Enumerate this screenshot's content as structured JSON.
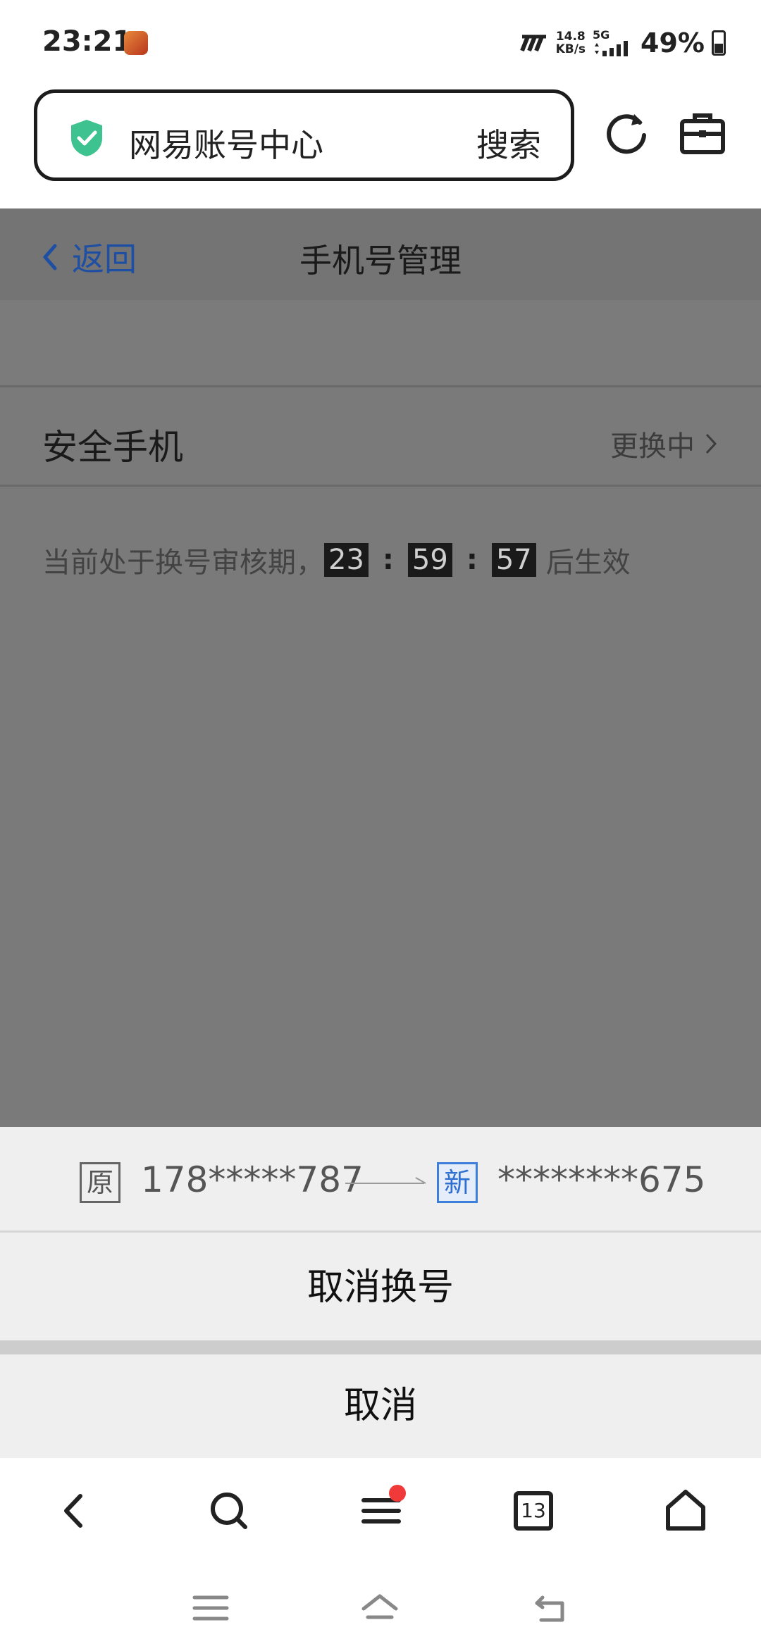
{
  "status_bar": {
    "time": "23:21",
    "net_speed_value": "14.8",
    "net_speed_unit": "KB/s",
    "network_type": "5G",
    "battery_percent": "49%",
    "battery_level": 0.49
  },
  "address_bar": {
    "site_text": "网易账号中心",
    "search_label": "搜索",
    "shield_icon": "shield-check-icon",
    "shield_color": "#3ec28f"
  },
  "page": {
    "back_label": "返回",
    "title": "手机号管理",
    "security_phone_label": "安全手机",
    "status_value": "更换中",
    "notice_prefix": "当前处于换号审核期，",
    "countdown_hours": "23",
    "countdown_minutes": "59",
    "countdown_seconds": "57",
    "countdown_sep": ":",
    "notice_suffix": "后生效",
    "accent_color": "#1e4fa3"
  },
  "sheet": {
    "old_tag": "原",
    "old_number": "178*****787",
    "new_tag": "新",
    "new_number": "********675",
    "cancel_change_label": "取消换号",
    "cancel_label": "取消"
  },
  "browser_nav": {
    "tab_count": "13",
    "icons": [
      "chevron-left-icon",
      "search-icon",
      "menu-icon",
      "tabs-icon",
      "home-icon"
    ],
    "notification_dot_color": "#f03a3a"
  },
  "system_nav": {
    "icons": [
      "menu-icon",
      "home-icon",
      "back-icon"
    ]
  }
}
